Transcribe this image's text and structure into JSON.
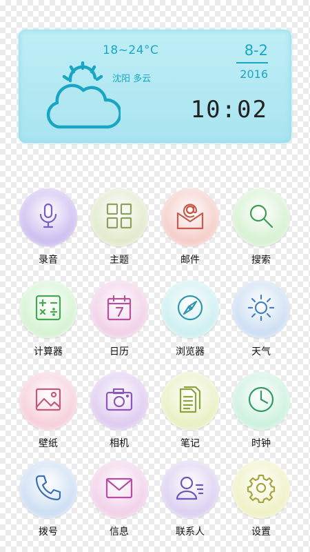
{
  "weather": {
    "temp_range": "18~24°C",
    "location": "沈阳  多云",
    "date": "8-2",
    "year": "2016",
    "time": "10:02",
    "icon": "partly-cloudy-icon",
    "accent_color": "#1aa6c3"
  },
  "apps": [
    {
      "label": "录音",
      "icon": "microphone-icon",
      "bg": "#c8b8ee",
      "stroke": "#7d5bc4"
    },
    {
      "label": "主题",
      "icon": "grid-icon",
      "bg": "#dfe8c8",
      "stroke": "#8aa25e"
    },
    {
      "label": "邮件",
      "icon": "mail-at-icon",
      "bg": "#f4c9c4",
      "stroke": "#c85a4a"
    },
    {
      "label": "搜索",
      "icon": "search-icon",
      "bg": "#d4f0cf",
      "stroke": "#3e9b52"
    },
    {
      "label": "计算器",
      "icon": "calculator-icon",
      "bg": "#d1f2cf",
      "stroke": "#45a552"
    },
    {
      "label": "日历",
      "icon": "calendar-icon",
      "bg": "#f0cde6",
      "stroke": "#b94e9a"
    },
    {
      "label": "浏览器",
      "icon": "compass-icon",
      "bg": "#c9eef0",
      "stroke": "#2f96b0"
    },
    {
      "label": "天气",
      "icon": "sun-icon",
      "bg": "#c9dcf2",
      "stroke": "#3f7fc2"
    },
    {
      "label": "壁纸",
      "icon": "picture-icon",
      "bg": "#f6cbd8",
      "stroke": "#c4587a"
    },
    {
      "label": "相机",
      "icon": "camera-icon",
      "bg": "#dcc6ef",
      "stroke": "#8c55bd"
    },
    {
      "label": "笔记",
      "icon": "notes-icon",
      "bg": "#e7efbf",
      "stroke": "#8ca23a"
    },
    {
      "label": "时钟",
      "icon": "clock-icon",
      "bg": "#c9f0dc",
      "stroke": "#2f9a62"
    },
    {
      "label": "拨号",
      "icon": "phone-icon",
      "bg": "#c9dcf2",
      "stroke": "#3c6eb4"
    },
    {
      "label": "信息",
      "icon": "envelope-icon",
      "bg": "#f0cde8",
      "stroke": "#b54ea3"
    },
    {
      "label": "联系人",
      "icon": "contacts-icon",
      "bg": "#d9cdf0",
      "stroke": "#6b55b8"
    },
    {
      "label": "设置",
      "icon": "gear-icon",
      "bg": "#eef0c1",
      "stroke": "#a8a43c"
    }
  ]
}
